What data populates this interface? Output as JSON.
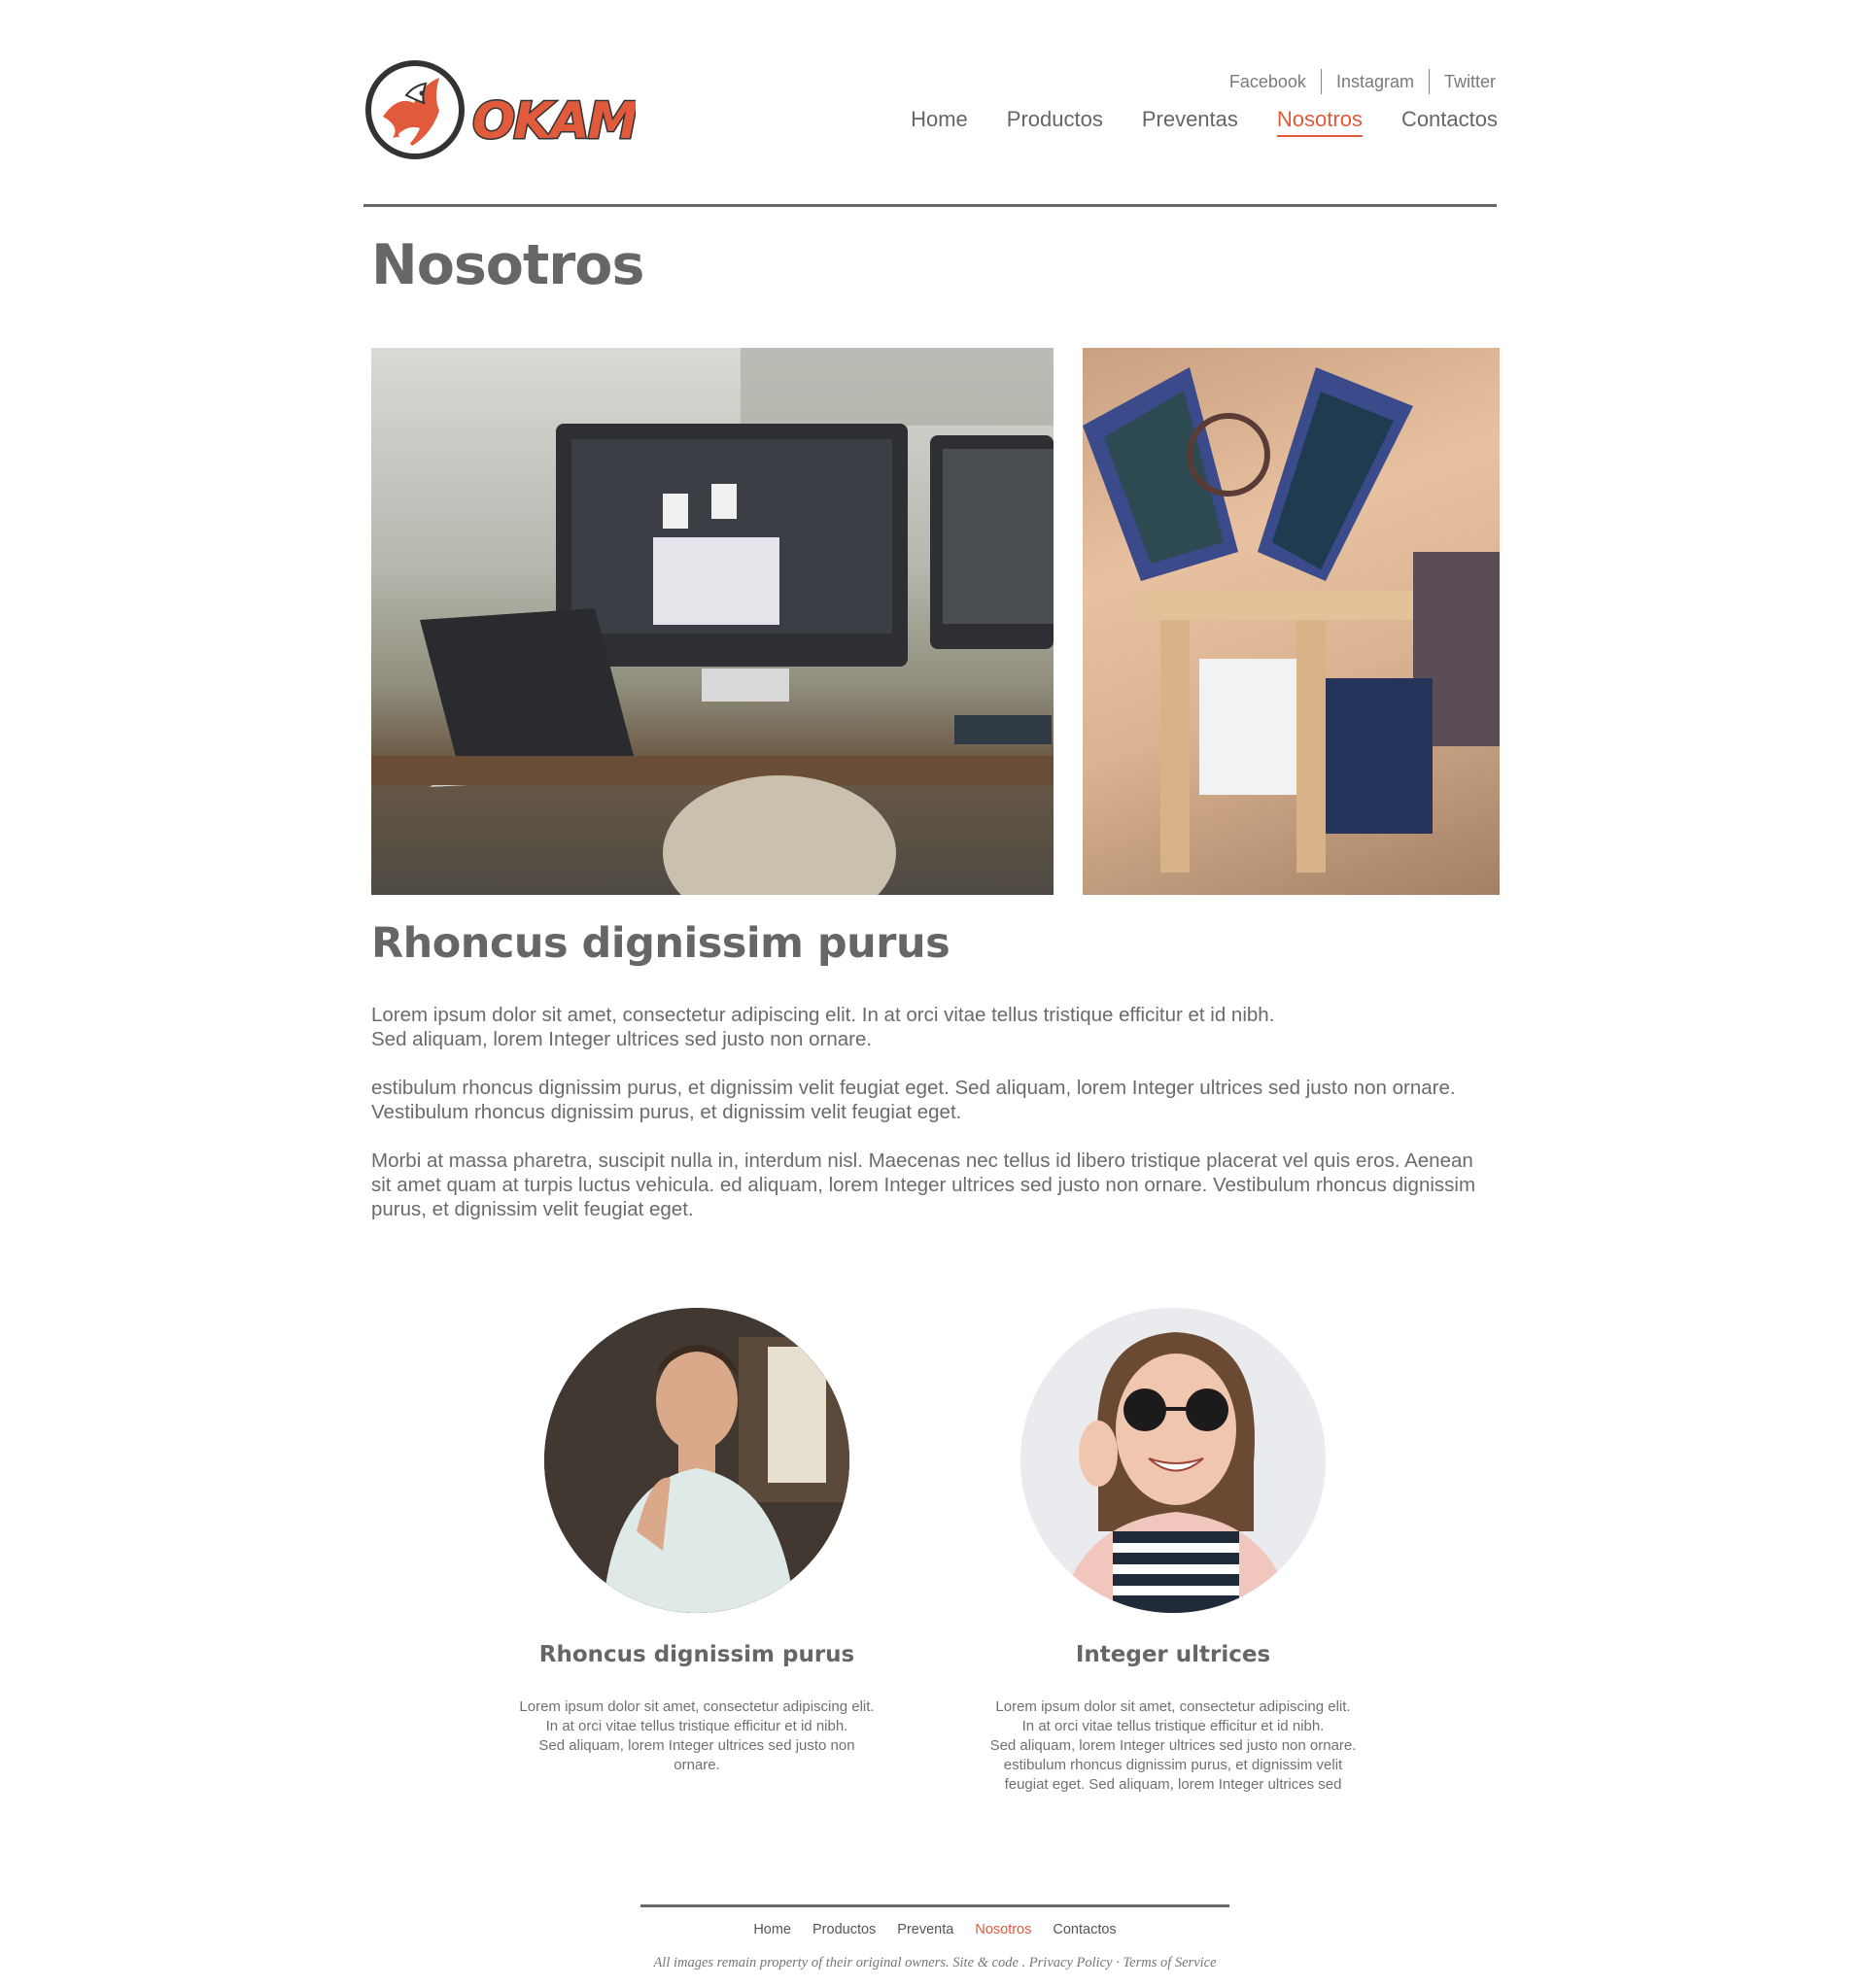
{
  "brand": {
    "logo_text": "OKAMI",
    "accent": "#e05a3b",
    "text_color": "#666666"
  },
  "social": [
    {
      "label": "Facebook"
    },
    {
      "label": "Instagram"
    },
    {
      "label": "Twitter"
    }
  ],
  "nav": {
    "items": [
      {
        "label": "Home"
      },
      {
        "label": "Productos"
      },
      {
        "label": "Preventas"
      },
      {
        "label": "Nosotros",
        "active": true
      },
      {
        "label": "Contactos"
      }
    ]
  },
  "page": {
    "title": "Nosotros",
    "section_title": "Rhoncus dignissim purus",
    "paragraphs": [
      "Lorem ipsum dolor sit amet, consectetur adipiscing elit. In at orci vitae tellus tristique efficitur et id nibh.\nSed aliquam, lorem Integer ultrices sed justo non ornare.",
      "estibulum rhoncus dignissim purus, et dignissim velit feugiat eget. Sed aliquam, lorem Integer ultrices sed justo non ornare. Vestibulum rhoncus dignissim purus, et dignissim velit feugiat eget.",
      "Morbi at massa pharetra, suscipit nulla in, interdum nisl. Maecenas nec tellus id libero tristique placerat vel quis eros. Aenean sit amet quam at turpis luctus vehicula. ed aliquam, lorem Integer ultrices sed justo non ornare. Vestibulum rhoncus dignissim purus, et dignissim velit feugiat eget."
    ]
  },
  "team": [
    {
      "name": "Rhoncus dignissim purus",
      "bio": "Lorem ipsum dolor sit amet, consectetur adipiscing elit.\nIn at orci vitae tellus tristique efficitur et id nibh.\nSed aliquam, lorem Integer ultrices sed justo non\nornare."
    },
    {
      "name": "Integer ultrices",
      "bio": "Lorem ipsum dolor sit amet, consectetur adipiscing elit.\nIn at orci vitae tellus tristique efficitur et id nibh.\nSed aliquam, lorem Integer ultrices sed justo non ornare.\nestibulum rhoncus dignissim purus, et dignissim velit\nfeugiat eget. Sed aliquam, lorem Integer ultrices sed"
    }
  ],
  "footer": {
    "nav": [
      {
        "label": "Home"
      },
      {
        "label": "Productos"
      },
      {
        "label": "Preventa"
      },
      {
        "label": "Nosotros",
        "active": true
      },
      {
        "label": "Contactos"
      }
    ],
    "credits": "All images remain property of their original owners. Site & code . Privacy Policy · Terms of Service"
  }
}
